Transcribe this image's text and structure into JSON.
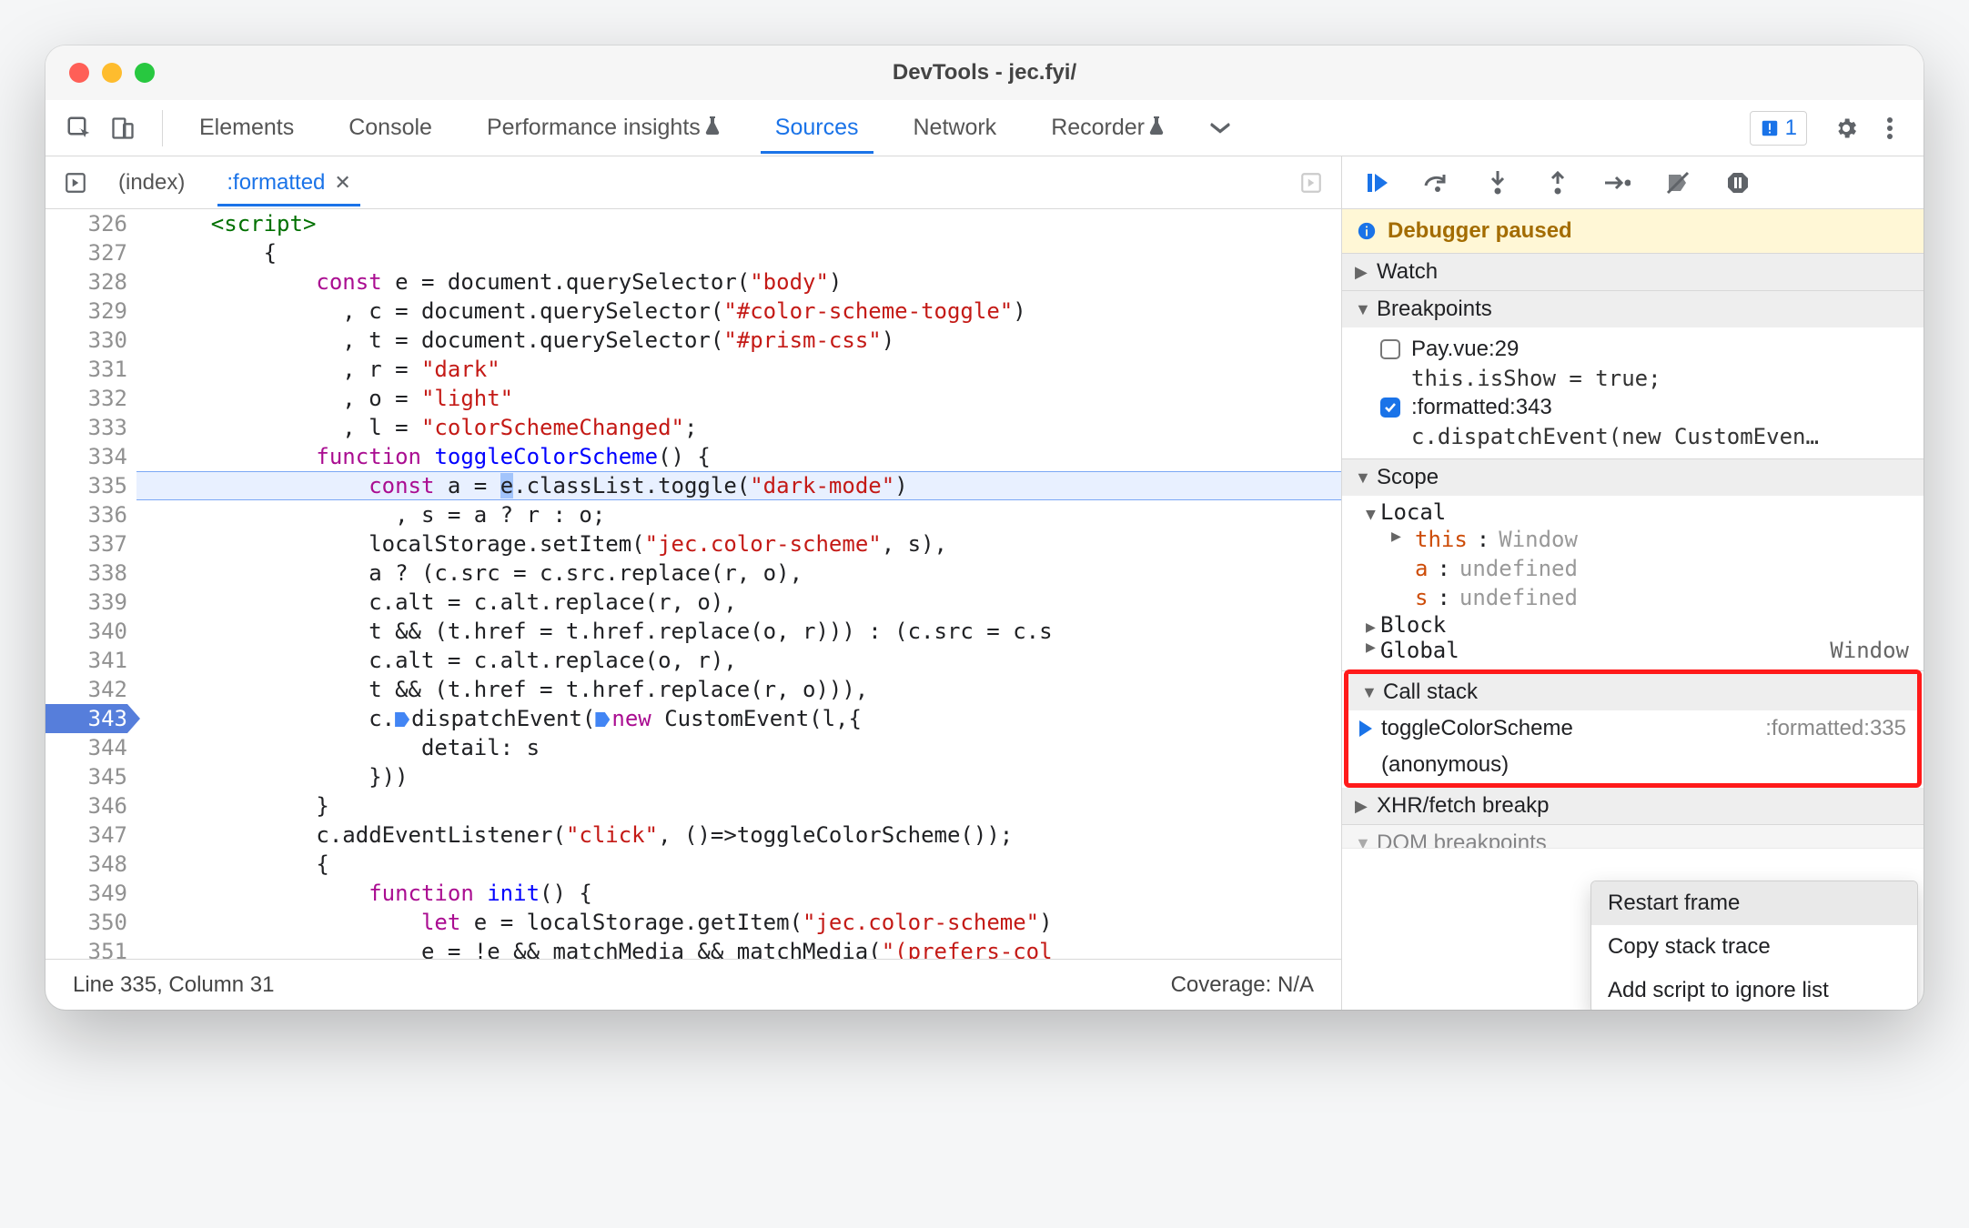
{
  "window": {
    "title": "DevTools - jec.fyi/"
  },
  "tabs": {
    "items": [
      "Elements",
      "Console",
      "Performance insights",
      "Sources",
      "Network",
      "Recorder"
    ],
    "flask_indices": [
      2,
      5
    ],
    "active": "Sources",
    "issues_count": "1"
  },
  "filebar": {
    "tabs": [
      {
        "label": "(index)",
        "active": false
      },
      {
        "label": ":formatted",
        "active": true
      }
    ]
  },
  "editor": {
    "first_line": 326,
    "active_gutter_line": 343,
    "highlight_line": 335,
    "lines": [
      {
        "html": "    <span class='xtag'>&lt;script&gt;</span>"
      },
      {
        "html": "        {"
      },
      {
        "html": "            <span class='kw'>const</span> e = document.querySelector(<span class='str'>\"body\"</span>)"
      },
      {
        "html": "              , c = document.querySelector(<span class='str'>\"#color-scheme-toggle\"</span>)"
      },
      {
        "html": "              , t = document.querySelector(<span class='str'>\"#prism-css\"</span>)"
      },
      {
        "html": "              , r = <span class='str'>\"dark\"</span>"
      },
      {
        "html": "              , o = <span class='str'>\"light\"</span>"
      },
      {
        "html": "              , l = <span class='str'>\"colorSchemeChanged\"</span>;"
      },
      {
        "html": "            <span class='kw'>function</span> <span class='fn'>toggleColorScheme</span>() {"
      },
      {
        "html": "                <span class='kw'>const</span> a = <span class='sel'>e</span>.classList.toggle(<span class='str'>\"dark-mode\"</span>)"
      },
      {
        "html": "                  , s = a ? r : o;"
      },
      {
        "html": "                localStorage.setItem(<span class='str'>\"jec.color-scheme\"</span>, s),"
      },
      {
        "html": "                a ? (c.src = c.src.replace(r, o),"
      },
      {
        "html": "                c.alt = c.alt.replace(r, o),"
      },
      {
        "html": "                t && (t.href = t.href.replace(o, r))) : (c.src = c.s"
      },
      {
        "html": "                c.alt = c.alt.replace(o, r),"
      },
      {
        "html": "                t && (t.href = t.href.replace(r, o))),"
      },
      {
        "html": "                c.<span class='step-marker'></span>dispatchEvent(<span class='step-marker'></span><span class='kw'>new</span> CustomEvent(l,{"
      },
      {
        "html": "                    detail: s"
      },
      {
        "html": "                }))"
      },
      {
        "html": "            }"
      },
      {
        "html": "            c.addEventListener(<span class='str'>\"click\"</span>, ()=&gt;toggleColorScheme());"
      },
      {
        "html": "            {"
      },
      {
        "html": "                <span class='kw'>function</span> <span class='fn'>init</span>() {"
      },
      {
        "html": "                    <span class='kw'>let</span> e = localStorage.getItem(<span class='str'>\"jec.color-scheme\"</span>)"
      },
      {
        "html": "                    e = !e && matchMedia && matchMedia(<span class='str'>\"(prefers-col</span>"
      }
    ]
  },
  "status": {
    "left": "Line 335, Column 31",
    "right": "Coverage: N/A"
  },
  "debugger": {
    "banner": "Debugger paused",
    "sections": {
      "watch": {
        "label": "Watch"
      },
      "breakpoints": {
        "label": "Breakpoints",
        "items": [
          {
            "checked": false,
            "title": "Pay.vue:29",
            "sub": "this.isShow = true;"
          },
          {
            "checked": true,
            "title": ":formatted:343",
            "sub": "c.dispatchEvent(new CustomEven…"
          }
        ]
      },
      "scope": {
        "label": "Scope",
        "local_label": "Local",
        "rows": [
          {
            "arrow": true,
            "name": "this",
            "value": "Window"
          },
          {
            "arrow": false,
            "name": "a",
            "value": "undefined"
          },
          {
            "arrow": false,
            "name": "s",
            "value": "undefined"
          }
        ],
        "block_label": "Block",
        "global_label": "Global",
        "global_value": "Window"
      },
      "callstack": {
        "label": "Call stack",
        "frames": [
          {
            "name": "toggleColorScheme",
            "location": ":formatted:335",
            "current": true
          },
          {
            "name": "(anonymous)",
            "location": "",
            "current": false
          }
        ]
      },
      "xhr": {
        "label": "XHR/fetch breakp"
      },
      "dom": {
        "label": "DOM breakpoints"
      }
    },
    "context_menu": [
      "Restart frame",
      "Copy stack trace",
      "Add script to ignore list"
    ]
  }
}
